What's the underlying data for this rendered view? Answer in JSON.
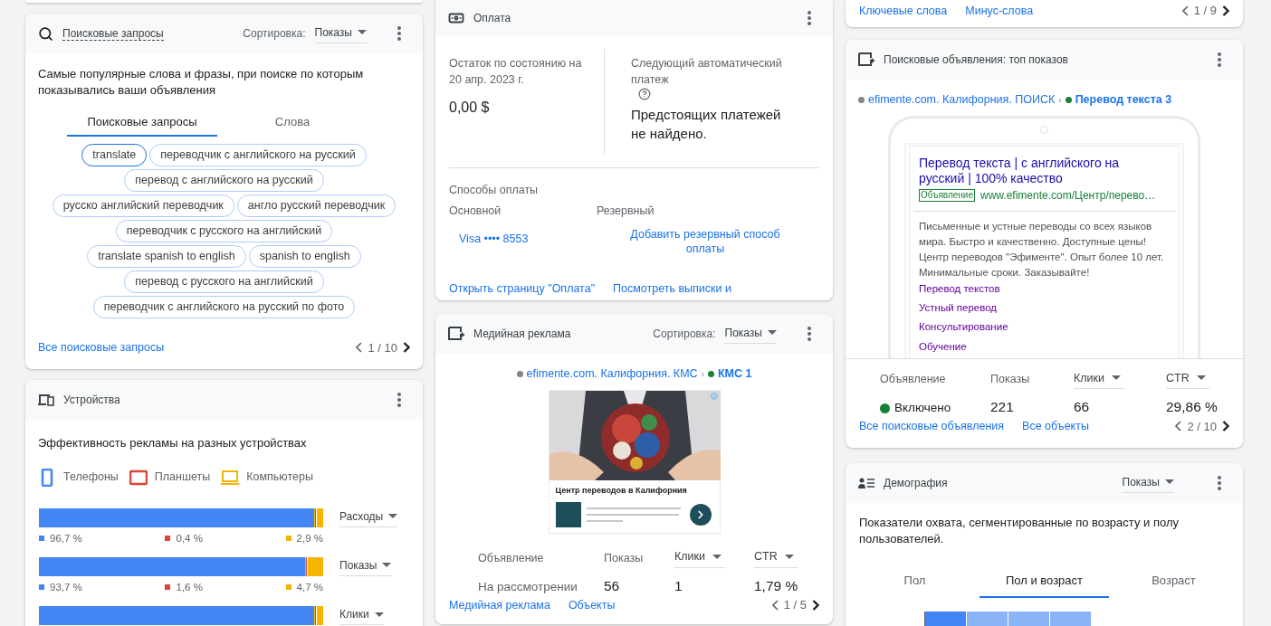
{
  "search_terms_card": {
    "title": "Поисковые запросы",
    "sort_label": "Сортировка:",
    "sort_value": "Показы",
    "description": "Самые популярные слова и фразы, при поиске по которым показывались ваши объявления",
    "tabs": [
      {
        "label": "Поисковые запросы",
        "selected": true
      },
      {
        "label": "Слова",
        "selected": false
      }
    ],
    "chips": [
      {
        "label": "translate",
        "selected": true
      },
      {
        "label": "переводчик с английского на русский",
        "selected": false
      },
      {
        "label": "перевод с английского на русский",
        "selected": false
      },
      {
        "label": "русско английский переводчик",
        "selected": false
      },
      {
        "label": "англо русский переводчик",
        "selected": false
      },
      {
        "label": "переводчик с русского на английский",
        "selected": false
      },
      {
        "label": "translate spanish to english",
        "selected": false
      },
      {
        "label": "spanish to english",
        "selected": false
      },
      {
        "label": "перевод с русского на английский",
        "selected": false
      },
      {
        "label": "переводчик с английского на русский по фото",
        "selected": false
      }
    ],
    "footer_link": "Все поисковые запросы",
    "pager": "1 / 10"
  },
  "devices_card": {
    "title": "Устройства",
    "description": "Эффективность рекламы на разных устройствах",
    "legend": [
      {
        "label": "Телефоны",
        "kind": "phone",
        "color": "#4285f4"
      },
      {
        "label": "Планшеты",
        "kind": "tablet",
        "color": "#db4437"
      },
      {
        "label": "Компьютеры",
        "kind": "computer",
        "color": "#f4b400"
      }
    ],
    "rows": [
      {
        "metric": "Расходы",
        "segments": [
          {
            "level": 0.967,
            "label": "96,7 %"
          },
          {
            "label": "0,4 %"
          },
          {
            "label": "2,9 %"
          }
        ]
      },
      {
        "metric": "Показы",
        "segments": [
          {
            "level": 0.937,
            "label": "93,7 %"
          },
          {
            "label": "1,6 %"
          },
          {
            "label": "4,7 %"
          }
        ]
      },
      {
        "metric": "Клики",
        "segments": [
          {
            "level": 0.967
          }
        ]
      }
    ]
  },
  "billing_card": {
    "title": "Оплата",
    "balance_label": "Остаток по состоянию на 20 апр. 2023 г.",
    "balance": "0,00 $",
    "next_payment_label": "Следующий автоматический платеж",
    "next_payment_value": "Предстоящих платежей не найдено.",
    "methods_title": "Способы оплаты",
    "primary_label": "Основной",
    "backup_label": "Резервный",
    "primary_card": "Visa •••• 8553",
    "add_backup": "Добавить резервный способ оплаты",
    "links": [
      "Открыть страницу \"Оплата\"",
      "Посмотреть выписки и"
    ]
  },
  "display_ads_card": {
    "title": "Медийная реклама",
    "sort_label": "Сортировка:",
    "sort_value": "Показы",
    "breadcrumb_separator": "›",
    "breadcrumb": [
      {
        "label": "efimente.com. Калифорния. КМС",
        "color": "#80868b"
      },
      {
        "label": "КМС 1",
        "color": "#188038"
      }
    ],
    "ad_headline": "Центр переводов в Калифорния",
    "stats": {
      "columns": [
        {
          "label": "Объявление",
          "sortable": false
        },
        {
          "label": "Показы",
          "sortable": false
        },
        {
          "label": "Клики",
          "sortable": true
        },
        {
          "label": "CTR",
          "sortable": true
        }
      ],
      "status": {
        "label": "На рассмотрении"
      },
      "values": [
        "56",
        "1",
        "1,79 %"
      ]
    },
    "links": [
      "Медийная реклама",
      "Объекты"
    ],
    "pager": "1 / 5"
  },
  "keywords_card": {
    "links": [
      "Ключевые слова",
      "Минус-слова"
    ],
    "pager": "1 / 9"
  },
  "search_ads_card": {
    "title": "Поисковые объявления: топ показов",
    "breadcrumb_separator": "›",
    "breadcrumb": [
      {
        "label": "efimente.com. Калифорния. ПОИСК",
        "color": "#80868b"
      },
      {
        "label": "Перевод текста 3",
        "color": "#188038"
      }
    ],
    "ad": {
      "headline": "Перевод текста | с английского на русский | 100% качество",
      "badge": "Объявление",
      "url": "www.efimente.com/Центр/перево…",
      "description": "Письменные и устные переводы со всех языков мира. Быстро и качественно. Доступные цены! Центр переводов \"Эфименте\". Опыт более 10 лет. Минимальные сроки. Заказывайте!",
      "sitelinks": [
        "Перевод текстов",
        "Устный перевод",
        "Консультирование",
        "Обучение"
      ]
    },
    "stats": {
      "columns": [
        {
          "label": "Объявление",
          "sortable": false
        },
        {
          "label": "Показы",
          "sortable": false
        },
        {
          "label": "Клики",
          "sortable": true
        },
        {
          "label": "CTR",
          "sortable": true
        }
      ],
      "status": {
        "label": "Включено",
        "color": "#188038"
      },
      "values": [
        "221",
        "66",
        "29,86 %"
      ]
    },
    "links": [
      "Все поисковые объявления",
      "Все объекты"
    ],
    "pager": "2 / 10"
  },
  "demographics_card": {
    "title": "Демография",
    "metric": "Показы",
    "description": "Показатели охвата, сегментированные по возрасту и полу пользователей.",
    "tabs": [
      {
        "label": "Пол",
        "selected": false
      },
      {
        "label": "Пол и возраст",
        "selected": true
      },
      {
        "label": "Возраст",
        "selected": false
      }
    ]
  }
}
